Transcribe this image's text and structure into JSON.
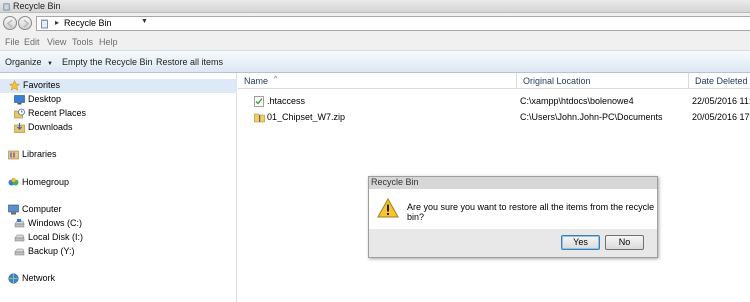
{
  "window": {
    "title": "Recycle Bin"
  },
  "address": {
    "location": "Recycle Bin",
    "separator": "▸",
    "dropdown": "▼"
  },
  "menu": [
    "File",
    "Edit",
    "View",
    "Tools",
    "Help"
  ],
  "toolbar": {
    "organize": "Organize",
    "organize_arrow": "▼",
    "empty": "Empty the Recycle Bin",
    "restore_all": "Restore all items"
  },
  "nav": {
    "favorites": {
      "label": "Favorites",
      "icon": "star-icon"
    },
    "favorites_items": [
      {
        "label": "Desktop",
        "icon": "desktop-icon"
      },
      {
        "label": "Recent Places",
        "icon": "recent-places-icon"
      },
      {
        "label": "Downloads",
        "icon": "downloads-icon"
      }
    ],
    "libraries": {
      "label": "Libraries",
      "icon": "libraries-icon"
    },
    "homegroup": {
      "label": "Homegroup",
      "icon": "homegroup-icon"
    },
    "computer": {
      "label": "Computer",
      "icon": "computer-icon"
    },
    "drives": [
      {
        "label": "Windows (C:)",
        "icon": "drive-icon"
      },
      {
        "label": "Local Disk (I:)",
        "icon": "drive-icon"
      },
      {
        "label": "Backup (Y:)",
        "icon": "drive-icon"
      }
    ],
    "network": {
      "label": "Network",
      "icon": "network-icon"
    }
  },
  "table": {
    "columns": [
      "Name",
      "Original Location",
      "Date Deleted"
    ],
    "sort_indicator": "^",
    "rows": [
      {
        "name": ".htaccess",
        "location": "C:\\xampp\\htdocs\\bolenowe4",
        "date": "22/05/2016 11:",
        "icon": "file-icon"
      },
      {
        "name": "01_Chipset_W7.zip",
        "location": "C:\\Users\\John.John-PC\\Documents",
        "date": "20/05/2016 17:",
        "icon": "zip-folder-icon"
      }
    ]
  },
  "dialog": {
    "title": "Recycle Bin",
    "message": "Are you sure you want to restore all the items from the recycle bin?",
    "yes": "Yes",
    "no": "No",
    "icon": "warning-icon"
  }
}
